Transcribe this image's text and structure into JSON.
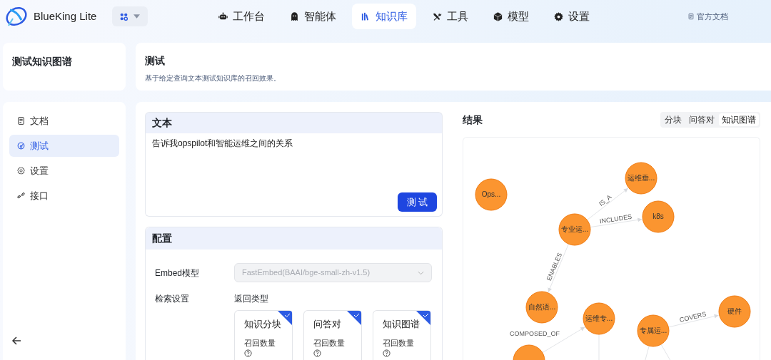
{
  "app": {
    "name": "BlueKing Lite"
  },
  "nav": [
    {
      "label": "工作台",
      "selected": false
    },
    {
      "label": "智能体",
      "selected": false
    },
    {
      "label": "知识库",
      "selected": true
    },
    {
      "label": "工具",
      "selected": false
    },
    {
      "label": "模型",
      "selected": false
    },
    {
      "label": "设置",
      "selected": false
    }
  ],
  "docs_link": "官方文档",
  "knowledge_base": {
    "title": "测试知识图谱"
  },
  "sidebar": {
    "items": [
      {
        "label": "文档",
        "selected": false
      },
      {
        "label": "测试",
        "selected": true
      },
      {
        "label": "设置",
        "selected": false
      },
      {
        "label": "接口",
        "selected": false
      }
    ]
  },
  "page": {
    "title": "测试",
    "description": "基于给定查询文本测试知识库的召回效果。"
  },
  "text_panel": {
    "title": "文本",
    "value": "告诉我opspilot和智能运维之间的关系",
    "button": "测 试"
  },
  "config": {
    "title": "配置",
    "embed_label": "Embed模型",
    "embed_value": "FastEmbed(BAAI/bge-small-zh-v1.5)",
    "retrieval_label": "检索设置",
    "return_type_label": "返回类型",
    "types": [
      {
        "title": "知识分块",
        "field": "召回数量",
        "checked": true
      },
      {
        "title": "问答对",
        "field": "召回数量",
        "checked": true
      },
      {
        "title": "知识图谱",
        "field": "召回数量",
        "checked": true
      }
    ]
  },
  "results": {
    "title": "结果",
    "tabs": [
      {
        "label": "分块",
        "selected": false
      },
      {
        "label": "问答对",
        "selected": false
      },
      {
        "label": "知识图谱",
        "selected": true
      }
    ],
    "graph": {
      "nodes": [
        {
          "label": "Ops..."
        },
        {
          "label": "运维垂..."
        },
        {
          "label": "k8s"
        },
        {
          "label": "专业运..."
        },
        {
          "label": "自然语..."
        },
        {
          "label": "运维专..."
        },
        {
          "label": "专属运..."
        },
        {
          "label": "硬件"
        }
      ],
      "edges": [
        {
          "label": "IS_A"
        },
        {
          "label": "INCLUDES"
        },
        {
          "label": "ENABLES"
        },
        {
          "label": "COMPOSED_OF"
        },
        {
          "label": "COVERS"
        }
      ]
    }
  }
}
